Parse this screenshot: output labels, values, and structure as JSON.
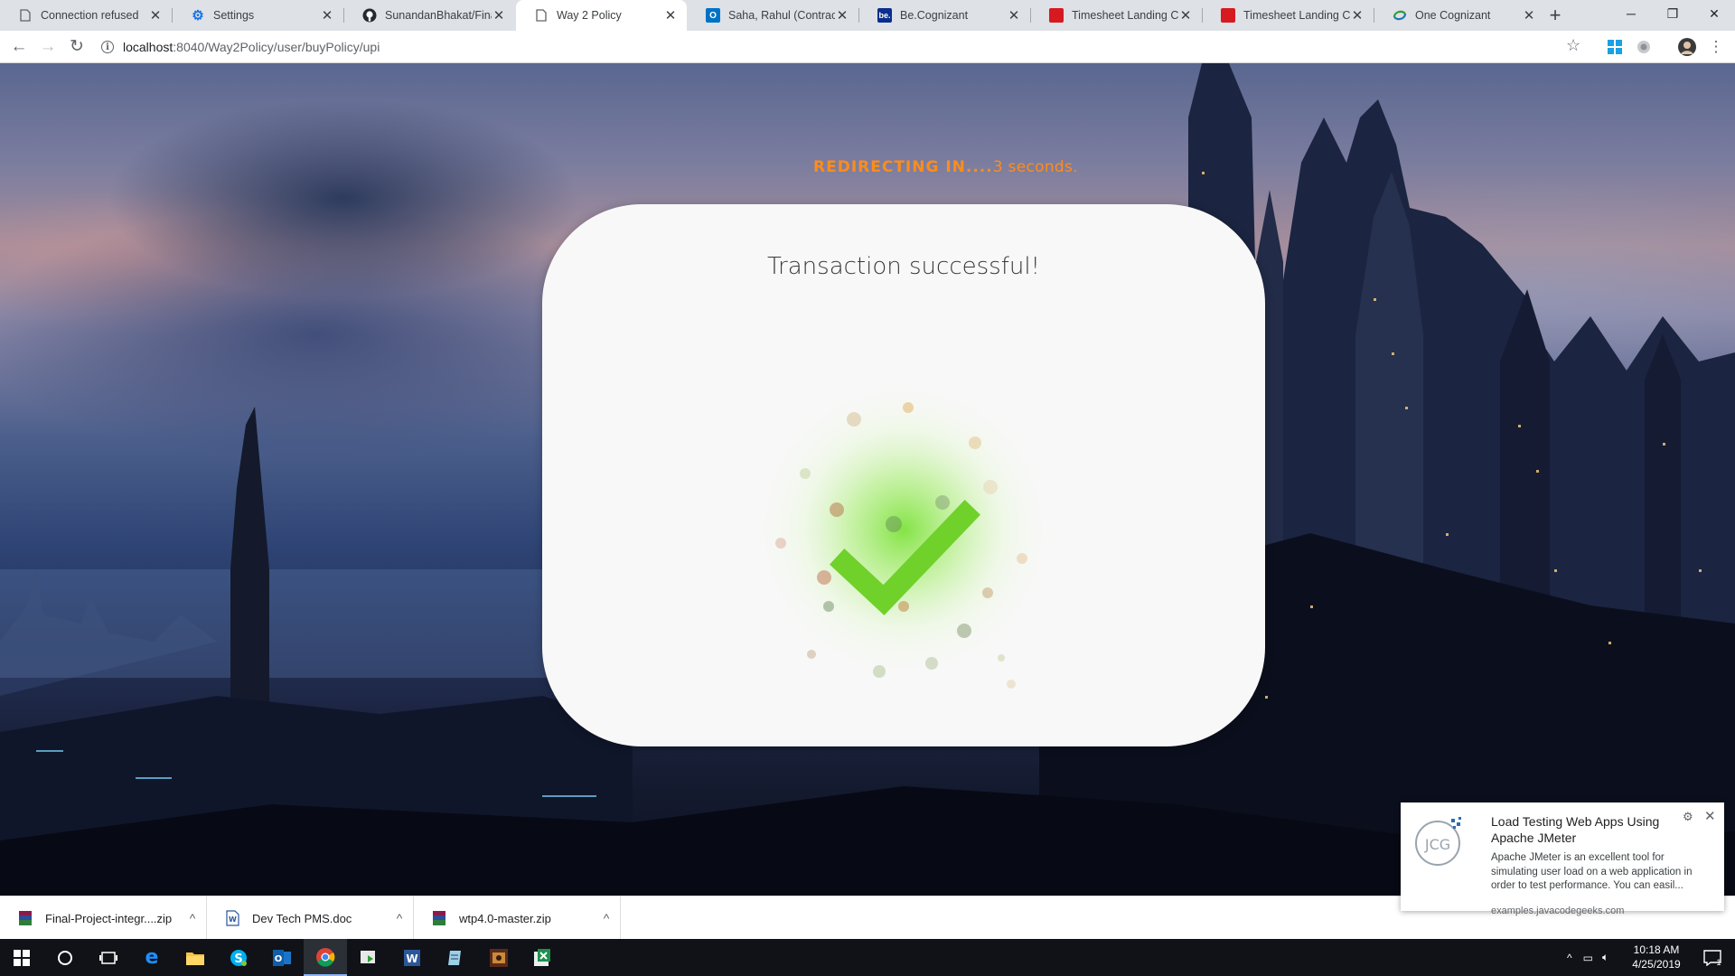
{
  "browser": {
    "tabs": [
      {
        "label": "Connection refused",
        "icon": "page-icon",
        "active": false
      },
      {
        "label": "Settings",
        "icon": "gear-icon",
        "active": false
      },
      {
        "label": "SunandanBhakat/Final-",
        "icon": "github-icon",
        "active": false
      },
      {
        "label": "Way 2 Policy",
        "icon": "page-icon",
        "active": true
      },
      {
        "label": "Saha, Rahul (Contractor",
        "icon": "outlook-icon",
        "active": false
      },
      {
        "label": "Be.Cognizant",
        "icon": "be-icon",
        "active": false
      },
      {
        "label": "Timesheet Landing Cor",
        "icon": "timesheet-icon",
        "active": false
      },
      {
        "label": "Timesheet Landing Cor",
        "icon": "timesheet-icon",
        "active": false
      },
      {
        "label": "One Cognizant",
        "icon": "onecognizant-icon",
        "active": false
      }
    ],
    "new_tab": "+",
    "url_host": "localhost",
    "url_path": ":8040/Way2Policy/user/buyPolicy/upi"
  },
  "page": {
    "redirect_prefix": "REDIRECTING IN....",
    "redirect_suffix": "3 seconds.",
    "card_title": "Transaction successful!"
  },
  "downloads": [
    {
      "name": "Final-Project-integr....zip",
      "icon": "winrar-icon"
    },
    {
      "name": "Dev Tech PMS.doc",
      "icon": "word-doc-icon"
    },
    {
      "name": "wtp4.0-master.zip",
      "icon": "winrar-icon"
    }
  ],
  "notification": {
    "title": "Load Testing Web Apps Using Apache JMeter",
    "body": "Apache JMeter is an excellent tool for simulating user load on a web application in order to test performance. You can easil...",
    "source": "examples.javacodegeeks.com",
    "logo": "JCG"
  },
  "taskbar": {
    "time": "10:18 AM",
    "date": "4/25/2019",
    "notification_count": "1"
  },
  "colors": {
    "accent_orange": "#ff8c1a",
    "success_green": "#6fd12a"
  }
}
